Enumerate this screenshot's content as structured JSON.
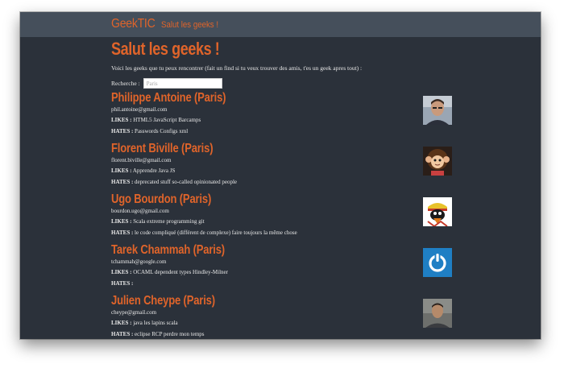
{
  "navbar": {
    "brand": "GeekTIC",
    "link": "Salut les geeks !"
  },
  "page": {
    "title": "Salut les geeks !",
    "intro": "Voici les geeks que tu peux rencontrer (fait un find si tu veux trouver des amis, t'es un geek apres tout) :",
    "search_label": "Recherche :",
    "search_placeholder": "Paris",
    "likes_label": "LIKES :",
    "hates_label": "HATES :"
  },
  "geeks": [
    {
      "name": "Philippe Antoine (Paris)",
      "email": "phil.antoine@gmail.com",
      "likes": "HTML5 JavaScript Barcamps",
      "hates": "Passwords Configs xml",
      "avatar": "photo-portrait"
    },
    {
      "name": "Florent Biville (Paris)",
      "email": "florent.biville@gmail.com",
      "likes": "Apprendre Java JS",
      "hates": "deprecated stuff so-called opinionated people",
      "avatar": "monkey-toy"
    },
    {
      "name": "Ugo Bourdon (Paris)",
      "email": "bourdon.ugo@gmail.com",
      "likes": "Scala extreme programming git",
      "hates": "le code compliqué (différent de complexe) faire toujours la même chose",
      "avatar": "cartoon-pirate"
    },
    {
      "name": "Tarek Chammah (Paris)",
      "email": "tchammah@google.com",
      "likes": "OCAML dependent types Hindley-Milner",
      "hates": "",
      "avatar": "power-logo"
    },
    {
      "name": "Julien Cheype (Paris)",
      "email": "cheype@gmail.com",
      "likes": "java les lapins scala",
      "hates": "eclipse RCP perdre mon temps",
      "avatar": "photo-portrait"
    }
  ],
  "colors": {
    "accent": "#e0642a",
    "navbar": "#454f5b",
    "background": "#2b313a",
    "text": "#e8e8e8"
  }
}
